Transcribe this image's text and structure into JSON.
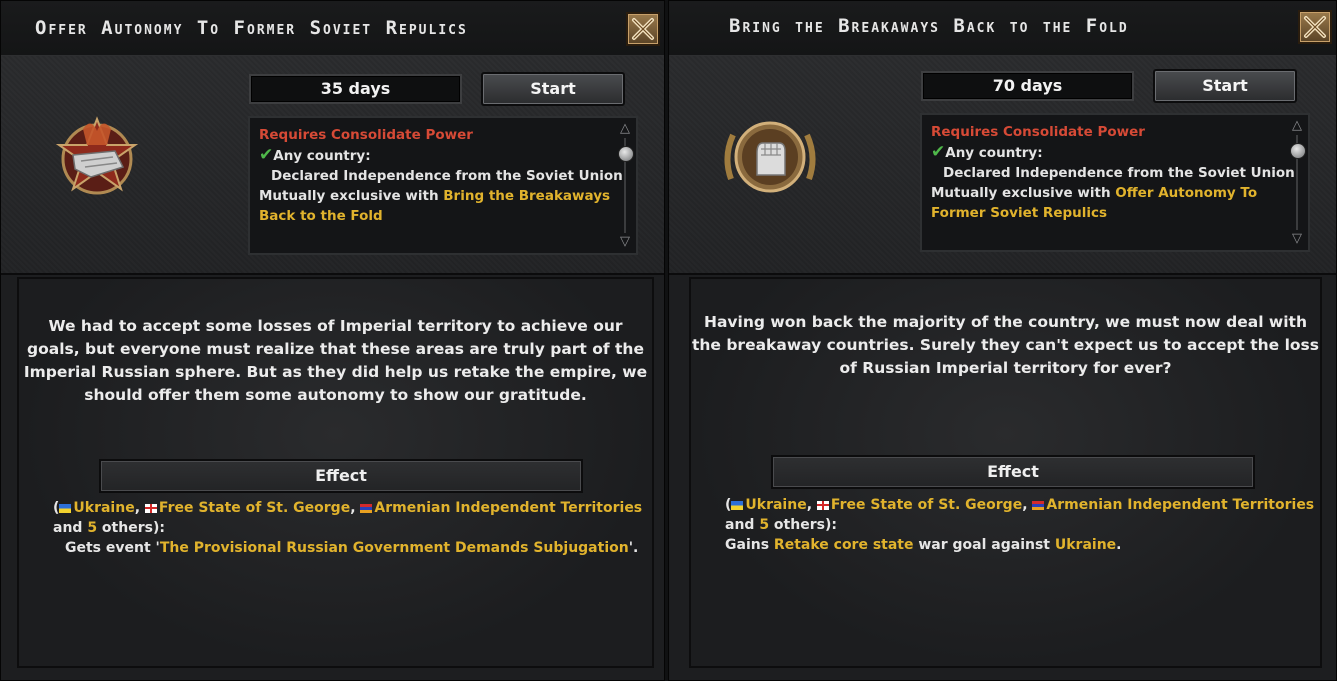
{
  "left": {
    "title": "Offer Autonomy To Former Soviet Repulics",
    "days": "35 days",
    "start_label": "Start",
    "icon": "red-star-hand-icon",
    "requirements": {
      "req_prefix": "Requires Consolidate Power",
      "any_country": "Any country:",
      "condition": "Declared Independence from the Soviet Union",
      "mutex_prefix": "Mutually exclusive with ",
      "mutex_line1": "Bring the Breakaways",
      "mutex_line2": "Back to the Fold"
    },
    "description": [
      "We had to accept some losses of Imperial territory to achieve our",
      "goals, but everyone must realize that these areas are truly part of the",
      "Imperial Russian sphere. But as they did help us retake the empire, we",
      "should offer them some autonomy to show our gratitude."
    ],
    "effect_label": "Effect",
    "effect": {
      "open": "(",
      "c1": "Ukraine",
      "sep1": ", ",
      "c2": "Free State of St. George",
      "sep2": ", ",
      "c3": "Armenian Independent Territories",
      "and": "and ",
      "count": "5",
      "others": " others):",
      "action_prefix": "Gets event '",
      "action_gold": "The Provisional Russian Government Demands Subjugation",
      "action_suffix": "'."
    }
  },
  "right": {
    "title": "Bring the Breakaways Back to the Fold",
    "days": "70 days",
    "start_label": "Start",
    "icon": "raised-fist-icon",
    "requirements": {
      "req_prefix": "Requires Consolidate Power",
      "any_country": "Any country:",
      "condition": "Declared Independence from the Soviet Union",
      "mutex_prefix": "Mutually exclusive with ",
      "mutex_line1": "Offer Autonomy To",
      "mutex_line2": "Former Soviet Repulics"
    },
    "description": [
      "Having won back the majority of the country, we must now deal with",
      "the breakaway countries. Surely they can't expect us to accept the loss",
      "of Russian Imperial territory for ever?"
    ],
    "effect_label": "Effect",
    "effect": {
      "open": "(",
      "c1": "Ukraine",
      "sep1": ", ",
      "c2": "Free State of St. George",
      "sep2": ", ",
      "c3": "Armenian Independent Territories",
      "and": "and ",
      "count": "5",
      "others": " others):",
      "action_prefix": "Gains ",
      "action_gold": "Retake core state",
      "action_mid": " war goal against ",
      "action_gold2": "Ukraine",
      "action_suffix": "."
    }
  },
  "colors": {
    "requirement_red": "#d64a36",
    "highlight_gold": "#e1b32d",
    "check_green": "#4fb84a"
  }
}
